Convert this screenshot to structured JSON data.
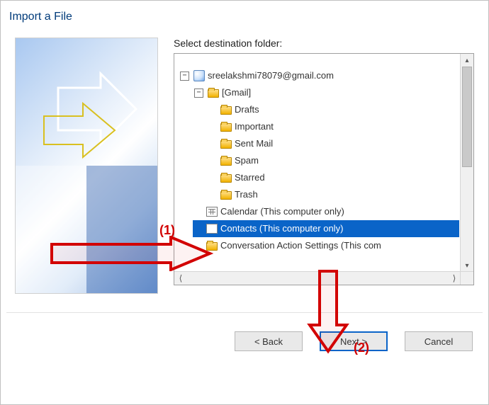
{
  "dialog": {
    "title": "Import a File"
  },
  "label": "Select destination folder:",
  "account": "sreelakshmi78079@gmail.com",
  "gmail_label": "[Gmail]",
  "folders": {
    "drafts": "Drafts",
    "important": "Important",
    "sentmail": "Sent Mail",
    "spam": "Spam",
    "starred": "Starred",
    "trash": "Trash"
  },
  "calendar": "Calendar (This computer only)",
  "contacts": "Contacts (This computer only)",
  "conversation": "Conversation Action Settings (This com",
  "buttons": {
    "back": "<  Back",
    "next": "Next  >",
    "cancel": "Cancel"
  },
  "annotations": {
    "marker1": "(1)",
    "marker2": "(2)"
  },
  "scroll": {
    "up": "▴",
    "down": "▾",
    "left": "⟨",
    "right": "⟩"
  }
}
